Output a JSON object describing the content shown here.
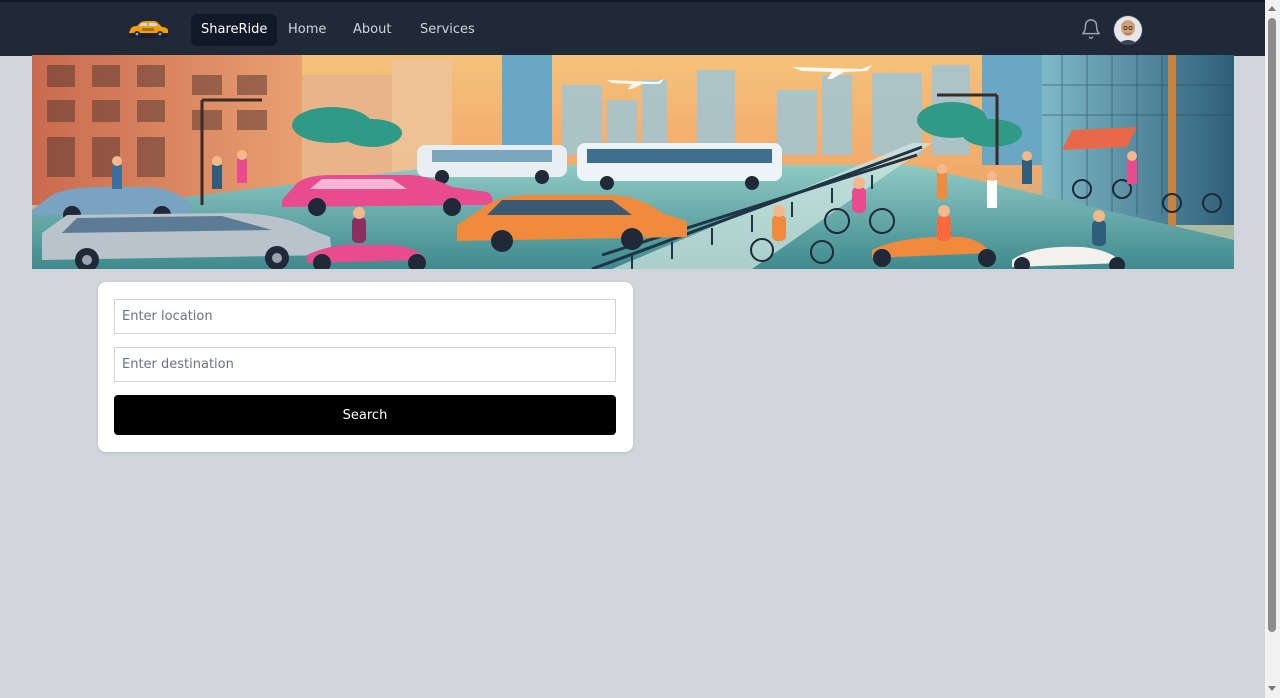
{
  "navbar": {
    "brand_label": "ShareRide",
    "links": [
      {
        "label": "Home"
      },
      {
        "label": "About"
      },
      {
        "label": "Services"
      }
    ],
    "notification_icon": "bell-icon",
    "logo_icon": "taxi-car-logo"
  },
  "search": {
    "location_placeholder": "Enter location",
    "destination_placeholder": "Enter destination",
    "button_label": "Search"
  },
  "colors": {
    "navbar_bg": "#1f2937",
    "page_bg": "#d1d5db",
    "button_bg": "#000000"
  }
}
